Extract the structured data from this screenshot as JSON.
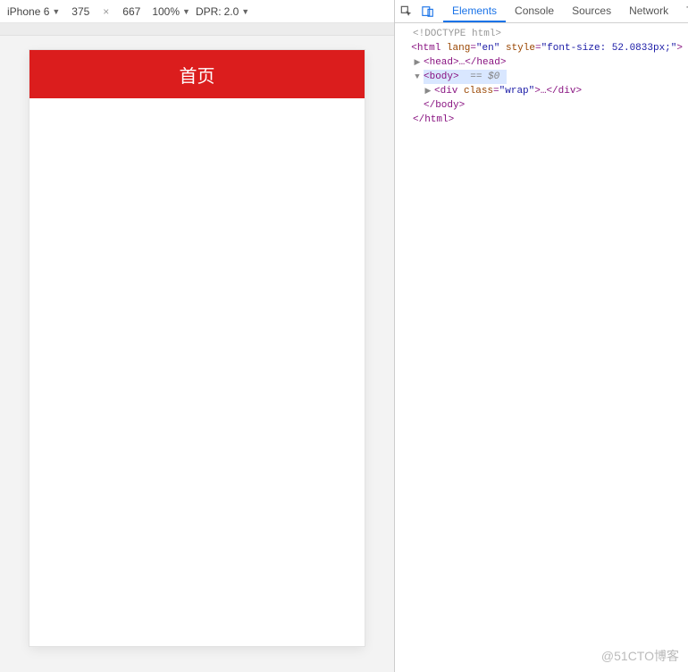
{
  "device_toolbar": {
    "device_name": "iPhone 6",
    "width": "375",
    "height": "667",
    "zoom": "100%",
    "dpr_label": "DPR:",
    "dpr_value": "2.0"
  },
  "app": {
    "header_title": "首页"
  },
  "devtools": {
    "tabs": {
      "elements": "Elements",
      "console": "Console",
      "sources": "Sources",
      "network": "Network",
      "tail": "T"
    },
    "selected_marker": "== $0"
  },
  "dom": {
    "doctype": "<!DOCTYPE html>",
    "html_open_prefix": "<html ",
    "html_lang_attr": "lang",
    "html_lang_val": "\"en\"",
    "html_style_attr": "style",
    "html_style_val": "\"font-size: 52.0833px;\"",
    "html_open_suffix": ">",
    "head": "<head>…</head>",
    "body_open": "<body>",
    "div_open_prefix": "<div ",
    "div_class_attr": "class",
    "div_class_val": "\"wrap\"",
    "div_open_suffix": ">…</div>",
    "body_close": "</body>",
    "html_close": "</html>"
  },
  "watermark": "@51CTO博客"
}
